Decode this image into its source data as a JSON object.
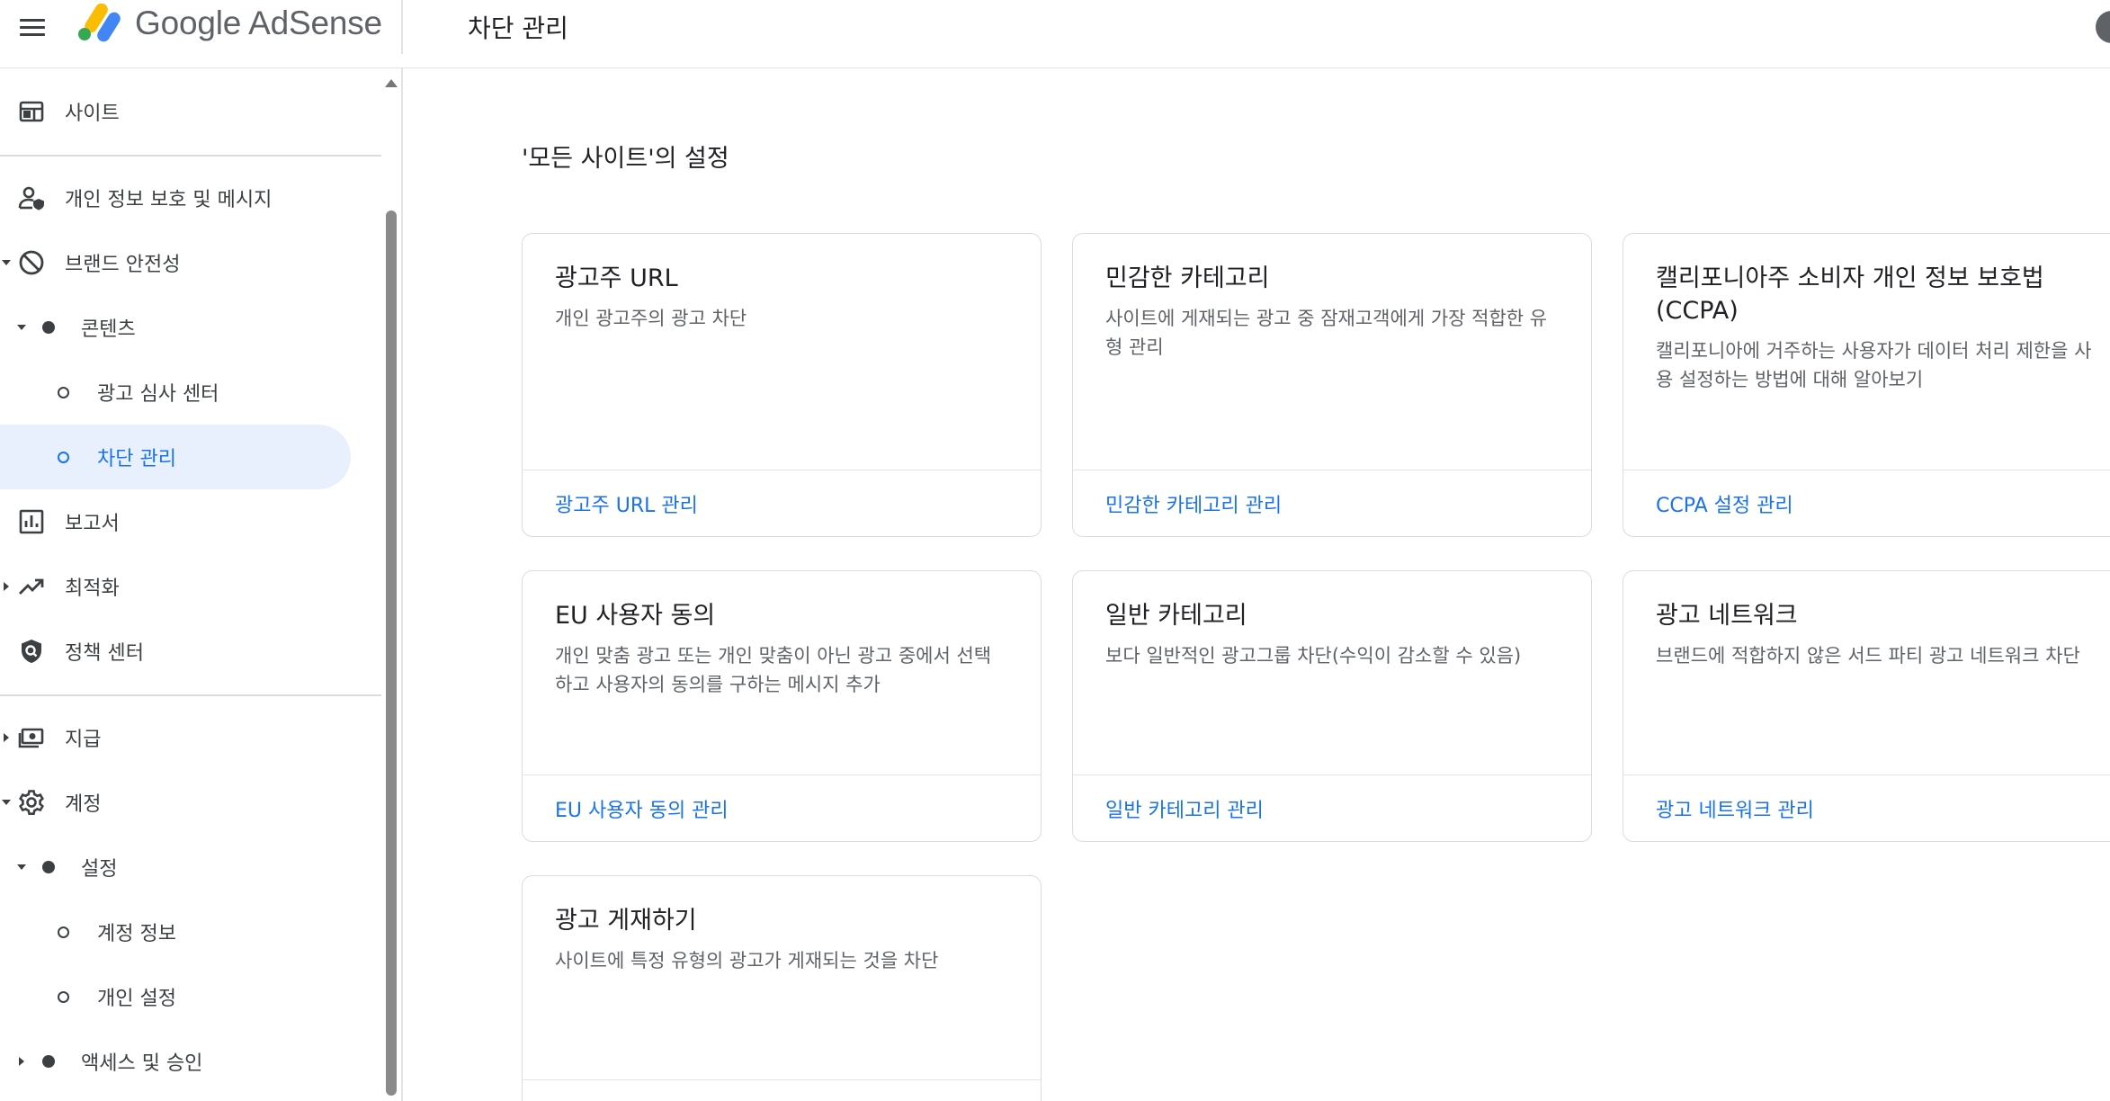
{
  "header": {
    "app_name": "Google AdSense",
    "page_title": "차단 관리"
  },
  "sidebar": {
    "items": [
      {
        "label": "사이트",
        "icon": "web-icon"
      },
      {
        "label": "개인 정보 보호 및 메시지",
        "icon": "privacy-person-icon"
      },
      {
        "label": "브랜드 안전성",
        "icon": "block-icon"
      },
      {
        "label": "콘텐츠"
      },
      {
        "label": "광고 심사 센터"
      },
      {
        "label": "차단 관리"
      },
      {
        "label": "보고서",
        "icon": "report-chart-icon"
      },
      {
        "label": "최적화",
        "icon": "trending-up-icon"
      },
      {
        "label": "정책 센터",
        "icon": "policy-shield-icon"
      },
      {
        "label": "지급",
        "icon": "payments-icon"
      },
      {
        "label": "계정",
        "icon": "gear-icon"
      },
      {
        "label": "설정"
      },
      {
        "label": "계정 정보"
      },
      {
        "label": "개인 설정"
      },
      {
        "label": "액세스 및 승인"
      }
    ]
  },
  "main": {
    "section_title": "'모든 사이트'의 설정",
    "cards": [
      {
        "title": "광고주 URL",
        "description": "개인 광고주의 광고 차단",
        "link": "광고주 URL 관리"
      },
      {
        "title": "민감한 카테고리",
        "description": "사이트에 게재되는 광고 중 잠재고객에게 가장 적합한 유형 관리",
        "link": "민감한 카테고리 관리"
      },
      {
        "title": "캘리포니아주 소비자 개인 정보 보호법(CCPA)",
        "description": "캘리포니아에 거주하는 사용자가 데이터 처리 제한을 사용 설정하는 방법에 대해 알아보기",
        "link": "CCPA 설정 관리"
      },
      {
        "title": "EU 사용자 동의",
        "description": "개인 맞춤 광고 또는 개인 맞춤이 아닌 광고 중에서 선택하고 사용자의 동의를 구하는 메시지 추가",
        "link": "EU 사용자 동의 관리"
      },
      {
        "title": "일반 카테고리",
        "description": "보다 일반적인 광고그룹 차단(수익이 감소할 수 있음)",
        "link": "일반 카테고리 관리"
      },
      {
        "title": "광고 네트워크",
        "description": "브랜드에 적합하지 않은 서드 파티 광고 네트워크 차단",
        "link": "광고 네트워크 관리"
      },
      {
        "title": "광고 게재하기",
        "description": "사이트에 특정 유형의 광고가 게재되는 것을 차단",
        "link": ""
      }
    ]
  },
  "colors": {
    "accent": "#1a73e8",
    "active_bg": "#e8f0fe",
    "text": "#3c4043",
    "border": "#dadce0",
    "logo_yellow": "#fbbc04",
    "logo_blue": "#4285f4",
    "logo_green": "#34a853"
  }
}
